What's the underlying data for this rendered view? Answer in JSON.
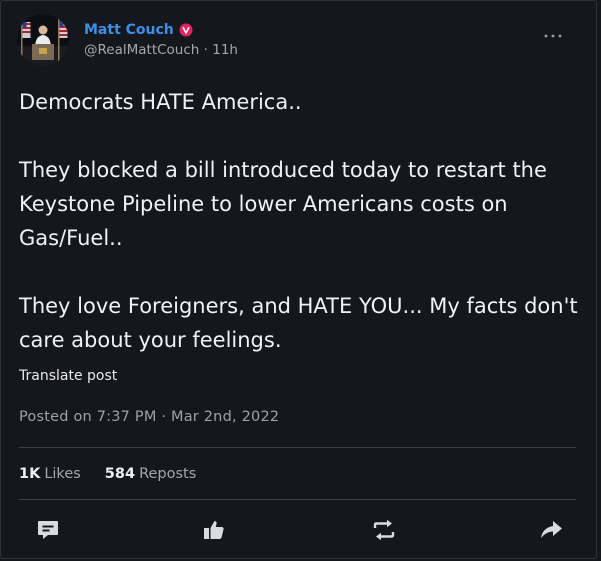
{
  "author": {
    "display_name": "Matt Couch",
    "handle": "@RealMattCouch",
    "separator": "·",
    "time_ago": "11h",
    "verified_icon": "verified-badge-icon",
    "verified_color": "#e0245e"
  },
  "more_icon": "ellipsis-icon",
  "tweet": {
    "paragraphs": [
      "Democrats HATE America..",
      "They blocked a bill introduced today to restart the\nKeystone Pipeline to lower Americans costs on\nGas/Fuel..",
      "They love Foreigners, and HATE YOU... My facts don't\ncare about your feelings."
    ]
  },
  "translate_label": "Translate post",
  "posted": "Posted on 7:37 PM · Mar 2nd, 2022",
  "stats": {
    "likes_count": "1K",
    "likes_label": "Likes",
    "reposts_count": "584",
    "reposts_label": "Reposts"
  },
  "actions": {
    "reply_icon": "comment-icon",
    "like_icon": "thumbs-up-icon",
    "repost_icon": "repost-icon",
    "share_icon": "share-arrow-icon"
  },
  "colors": {
    "background": "#15171e",
    "name": "#3d8fe6",
    "text": "#f1f2f3",
    "muted": "#9ca1a6",
    "icon": "#d9dcdf"
  }
}
